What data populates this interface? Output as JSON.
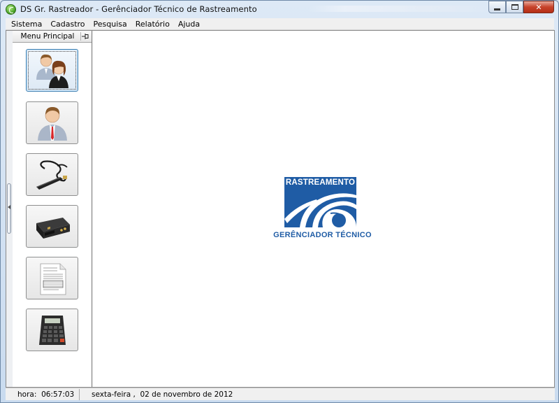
{
  "window": {
    "title": "DS Gr. Rastreador - Gerênciador Técnico de Rastreamento",
    "buttons": [
      "minimize",
      "maximize",
      "close"
    ]
  },
  "menubar": {
    "items": [
      "Sistema",
      "Cadastro",
      "Pesquisa",
      "Relatório",
      "Ajuda"
    ]
  },
  "side_panel": {
    "header": "Menu Principal",
    "buttons": [
      {
        "name": "users-icon",
        "selected": true
      },
      {
        "name": "user-icon",
        "selected": false
      },
      {
        "name": "antenna-icon",
        "selected": false
      },
      {
        "name": "tracker-device-icon",
        "selected": false
      },
      {
        "name": "document-icon",
        "selected": false
      },
      {
        "name": "calculator-icon",
        "selected": false
      }
    ]
  },
  "logo": {
    "title": "RASTREAMENTO",
    "subtitle": "GERÊNCIADOR TÉCNICO"
  },
  "status": {
    "time_label": "hora:",
    "time_value": "06:57:03",
    "date_text": "sexta-feira ,  02 de novembro de 2012"
  },
  "colors": {
    "brand_blue": "#1f5ca5",
    "close_red": "#c7432b"
  }
}
